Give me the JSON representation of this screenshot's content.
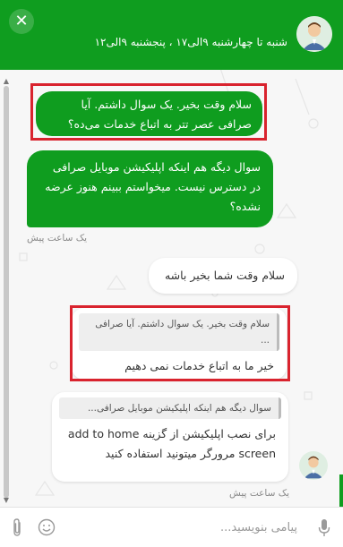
{
  "header": {
    "close_icon": "✕",
    "hours_text": "شنبه تا چهارشنبه ۹الی۱۷ ، پنجشنبه ۹الی۱۲"
  },
  "messages": {
    "m1_text": "سلام وقت بخیر. یک سوال داشتم. آیا صرافی عصر تتر به اتباع خدمات می‌ده؟",
    "m2_text": "سوال دیگه هم اینکه اپلیکیشن موبایل صرافی در دسترس نیست. میخواستم ببینم هنوز عرضه نشده؟",
    "time1": "یک ساعت پیش",
    "m3_text": "سلام وقت شما بخیر باشه",
    "m4_quote": "سلام وقت بخیر. یک سوال داشتم. آیا صرافی ...",
    "m4_text": "خیر ما به اتباع خدمات نمی دهیم",
    "m5_quote": "سوال دیگه هم اینکه اپلیکیشن موبایل صرافی...",
    "m5_text": "برای نصب اپلیکیشن از گزینه add to home screen مرورگر میتونید استفاده کنید",
    "time2": "یک ساعت پیش"
  },
  "composer": {
    "placeholder": "پیامی بنویسید..."
  },
  "colors": {
    "brand_green": "#0f9d1f",
    "highlight_red": "#d9232e"
  }
}
